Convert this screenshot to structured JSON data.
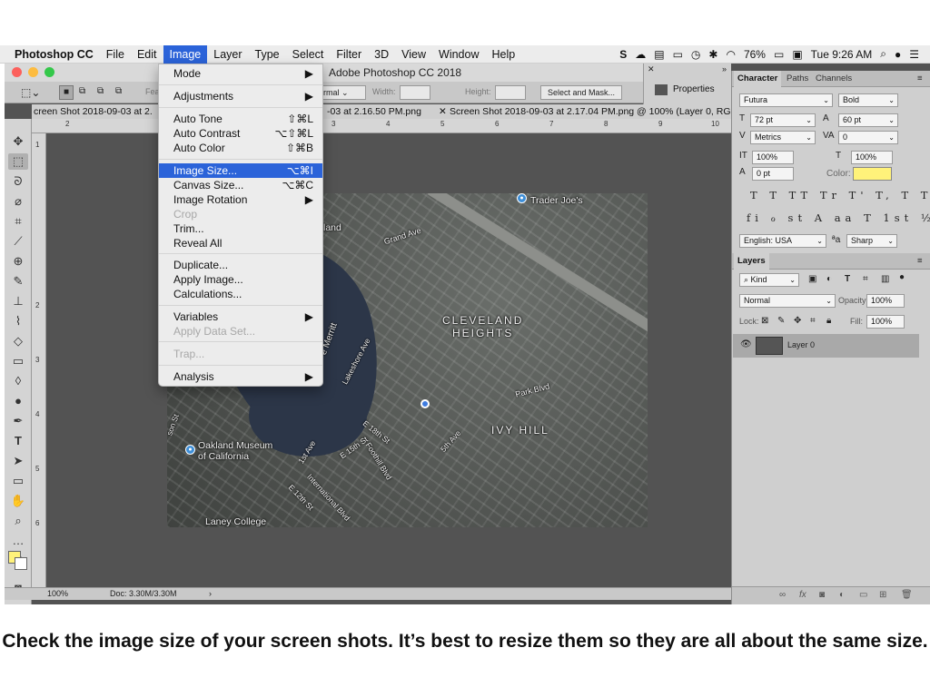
{
  "menubar": {
    "app_name": "Photoshop CC",
    "items": [
      "File",
      "Edit",
      "Image",
      "Layer",
      "Type",
      "Select",
      "Filter",
      "3D",
      "View",
      "Window",
      "Help"
    ],
    "active_item": "Image",
    "battery": "76%",
    "clock": "Tue 9:26 AM"
  },
  "window": {
    "title": "Adobe Photoshop CC 2018",
    "traffic_light_colors": [
      "#fc605c",
      "#fdbc40",
      "#34c84a"
    ]
  },
  "options_bar": {
    "style_value": "rmal",
    "width_label": "Width:",
    "height_label": "Height:",
    "select_mask_button": "Select and Mask...",
    "feather_label": "Fea"
  },
  "tabs": [
    "creen Shot 2018-09-03 at 2.",
    "-03 at 2.16.50 PM.png",
    "Screen Shot 2018-09-03 at 2.17.04 PM.png @ 100% (Layer 0, RGB/"
  ],
  "ruler": {
    "top_ticks": [
      "2",
      "3",
      "4",
      "5",
      "6",
      "7",
      "8",
      "9",
      "10"
    ],
    "left_ticks": [
      "1",
      "2",
      "3",
      "4",
      "5",
      "6"
    ]
  },
  "map_labels": {
    "trader_joes": "Trader Joe's",
    "grand_ave": "Grand Ave",
    "island": "land",
    "cleveland_heights": "CLEVELAND\nHEIGHTS",
    "merritt": "e Merritt",
    "lakeshore": "Lakeshore Ave",
    "park_blvd": "Park Blvd",
    "ivy_hill": "IVY HILL",
    "e18th": "E 18th St",
    "foothill": "Foothill Blvd",
    "fifth_ave": "5th Ave",
    "oakland_museum": "Oakland Museum\nof California",
    "first_ave": "1st Ave",
    "international": "International Blvd",
    "e12th": "E 12th St",
    "laney": "Laney College",
    "e15th": "E 15th St",
    "mon": "son St"
  },
  "status_bar": {
    "zoom": "100%",
    "doc": "Doc: 3.30M/3.30M"
  },
  "properties_panel": {
    "label": "Properties"
  },
  "character_panel": {
    "tabs": [
      "Character",
      "Paths",
      "Channels"
    ],
    "font_family": "Futura",
    "font_style": "Bold",
    "font_size": "72 pt",
    "leading": "60 pt",
    "kerning": "Metrics",
    "tracking": "0",
    "vertical_scale": "100%",
    "horizontal_scale": "100%",
    "baseline_shift": "0 pt",
    "color_label": "Color:",
    "text_color": "#fff27a",
    "style_glyphs": "T T TT Tr T' T, T T",
    "opentype_glyphs": "fi ℴ st A aa T 1st ½",
    "language": "English: USA",
    "aa_label": "ªa",
    "antialias": "Sharp"
  },
  "layers_panel": {
    "tab": "Layers",
    "filter_kind": "Kind",
    "blend_mode": "Normal",
    "opacity_label": "Opacity:",
    "opacity": "100%",
    "lock_label": "Lock:",
    "fill_label": "Fill:",
    "fill": "100%",
    "layer_name": "Layer 0"
  },
  "image_menu": {
    "items": [
      {
        "label": "Mode",
        "shortcut": "▶"
      },
      {
        "label": "Adjustments",
        "shortcut": "▶"
      },
      {
        "label": "Auto Tone",
        "shortcut": "⇧⌘L"
      },
      {
        "label": "Auto Contrast",
        "shortcut": "⌥⇧⌘L"
      },
      {
        "label": "Auto Color",
        "shortcut": "⇧⌘B"
      },
      {
        "label": "Image Size...",
        "shortcut": "⌥⌘I"
      },
      {
        "label": "Canvas Size...",
        "shortcut": "⌥⌘C"
      },
      {
        "label": "Image Rotation",
        "shortcut": "▶"
      },
      {
        "label": "Crop",
        "shortcut": ""
      },
      {
        "label": "Trim...",
        "shortcut": ""
      },
      {
        "label": "Reveal All",
        "shortcut": ""
      },
      {
        "label": "Duplicate...",
        "shortcut": ""
      },
      {
        "label": "Apply Image...",
        "shortcut": ""
      },
      {
        "label": "Calculations...",
        "shortcut": ""
      },
      {
        "label": "Variables",
        "shortcut": "▶"
      },
      {
        "label": "Apply Data Set...",
        "shortcut": ""
      },
      {
        "label": "Trap...",
        "shortcut": ""
      },
      {
        "label": "Analysis",
        "shortcut": "▶"
      }
    ],
    "highlighted": "Image Size..."
  },
  "caption": "Check the image size of your screen shots. It’s best to resize them so they are all about the same size."
}
